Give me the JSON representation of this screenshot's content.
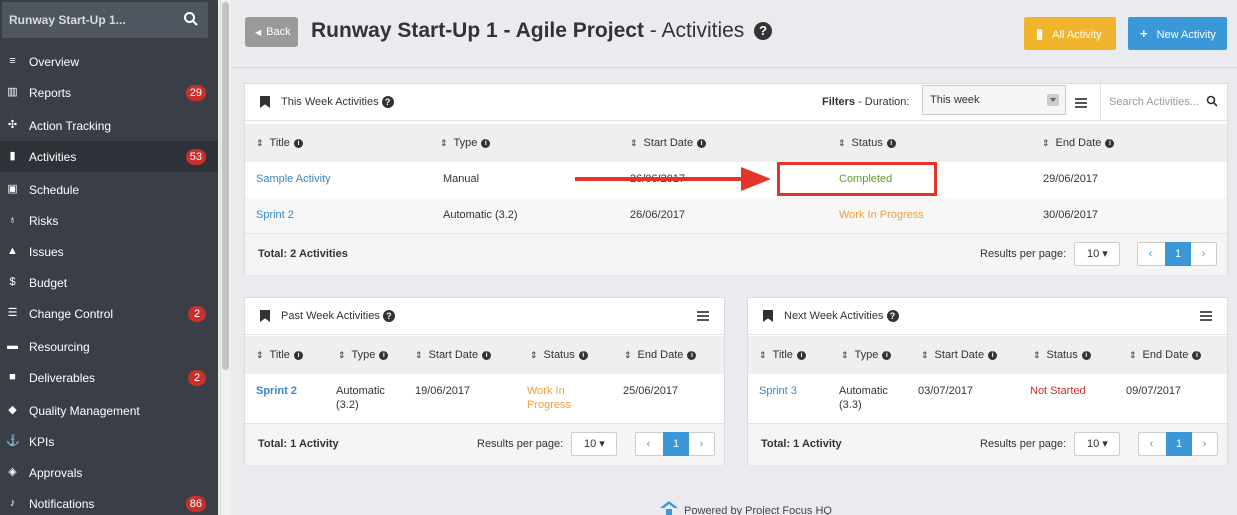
{
  "sidebar": {
    "project_name": "Runway Start-Up 1...",
    "items": [
      {
        "label": "Overview",
        "badge": ""
      },
      {
        "label": "Reports",
        "badge": "29"
      },
      {
        "label": "Action Tracking",
        "badge": ""
      },
      {
        "label": "Activities",
        "badge": "53"
      },
      {
        "label": "Schedule",
        "badge": ""
      },
      {
        "label": "Risks",
        "badge": ""
      },
      {
        "label": "Issues",
        "badge": ""
      },
      {
        "label": "Budget",
        "badge": ""
      },
      {
        "label": "Change Control",
        "badge": "2"
      },
      {
        "label": "Resourcing",
        "badge": ""
      },
      {
        "label": "Deliverables",
        "badge": "2"
      },
      {
        "label": "Quality Management",
        "badge": ""
      },
      {
        "label": "KPIs",
        "badge": ""
      },
      {
        "label": "Approvals",
        "badge": ""
      },
      {
        "label": "Notifications",
        "badge": "86"
      }
    ]
  },
  "header": {
    "back_label": "Back",
    "title_project": "Runway Start-Up 1 - Agile Project",
    "title_suffix": " - Activities",
    "all_activity_label": "All Activity",
    "new_activity_label": "New Activity"
  },
  "this_week": {
    "title": "This Week Activities",
    "filters_label": "Filters",
    "duration_label": " - Duration:",
    "duration_value": "This week",
    "search_placeholder": "Search Activities...",
    "columns": [
      "Title",
      "Type",
      "Start Date",
      "Status",
      "End Date"
    ],
    "rows": [
      {
        "title": "Sample Activity",
        "type": "Manual",
        "start": "26/06/2017",
        "status": "Completed",
        "end": "29/06/2017"
      },
      {
        "title": "Sprint 2",
        "type": "Automatic (3.2)",
        "start": "26/06/2017",
        "status": "Work In Progress",
        "end": "30/06/2017"
      }
    ],
    "total": "Total: 2 Activities",
    "results_per_page_label": "Results per page:",
    "per_page_value": "10",
    "current_page": "1"
  },
  "past_week": {
    "title": "Past Week Activities",
    "columns": [
      "Title",
      "Type",
      "Start Date",
      "Status",
      "End Date"
    ],
    "rows": [
      {
        "title": "Sprint 2",
        "type_line1": "Automatic",
        "type_line2": "(3.2)",
        "start": "19/06/2017",
        "status_line1": "Work In",
        "status_line2": "Progress",
        "end": "25/06/2017"
      }
    ],
    "total": "Total: 1 Activity",
    "results_per_page_label": "Results per page:",
    "per_page_value": "10",
    "current_page": "1"
  },
  "next_week": {
    "title": "Next Week Activities",
    "columns": [
      "Title",
      "Type",
      "Start Date",
      "Status",
      "End Date"
    ],
    "rows": [
      {
        "title": "Sprint 3",
        "type_line1": "Automatic",
        "type_line2": "(3.3)",
        "start": "03/07/2017",
        "status": "Not Started",
        "end": "09/07/2017"
      }
    ],
    "total": "Total: 1 Activity",
    "results_per_page_label": "Results per page:",
    "per_page_value": "10",
    "current_page": "1"
  },
  "footer": {
    "powered_by": "Powered by Project Focus HQ"
  },
  "colors": {
    "sidebar_bg": "#3a3f47",
    "badge_red": "#c9302c",
    "accent_blue": "#3a98d8",
    "accent_yellow": "#f0b52c",
    "status_completed": "#5a9e2a",
    "status_wip": "#f0a03c",
    "status_not_started": "#c9302c",
    "annotation_red": "#e5352a"
  },
  "icons": {
    "search": "search-icon",
    "sort": "sort-icon",
    "help": "help-icon",
    "bookmark": "bookmark-icon",
    "menu": "hamburger-menu-icon"
  }
}
